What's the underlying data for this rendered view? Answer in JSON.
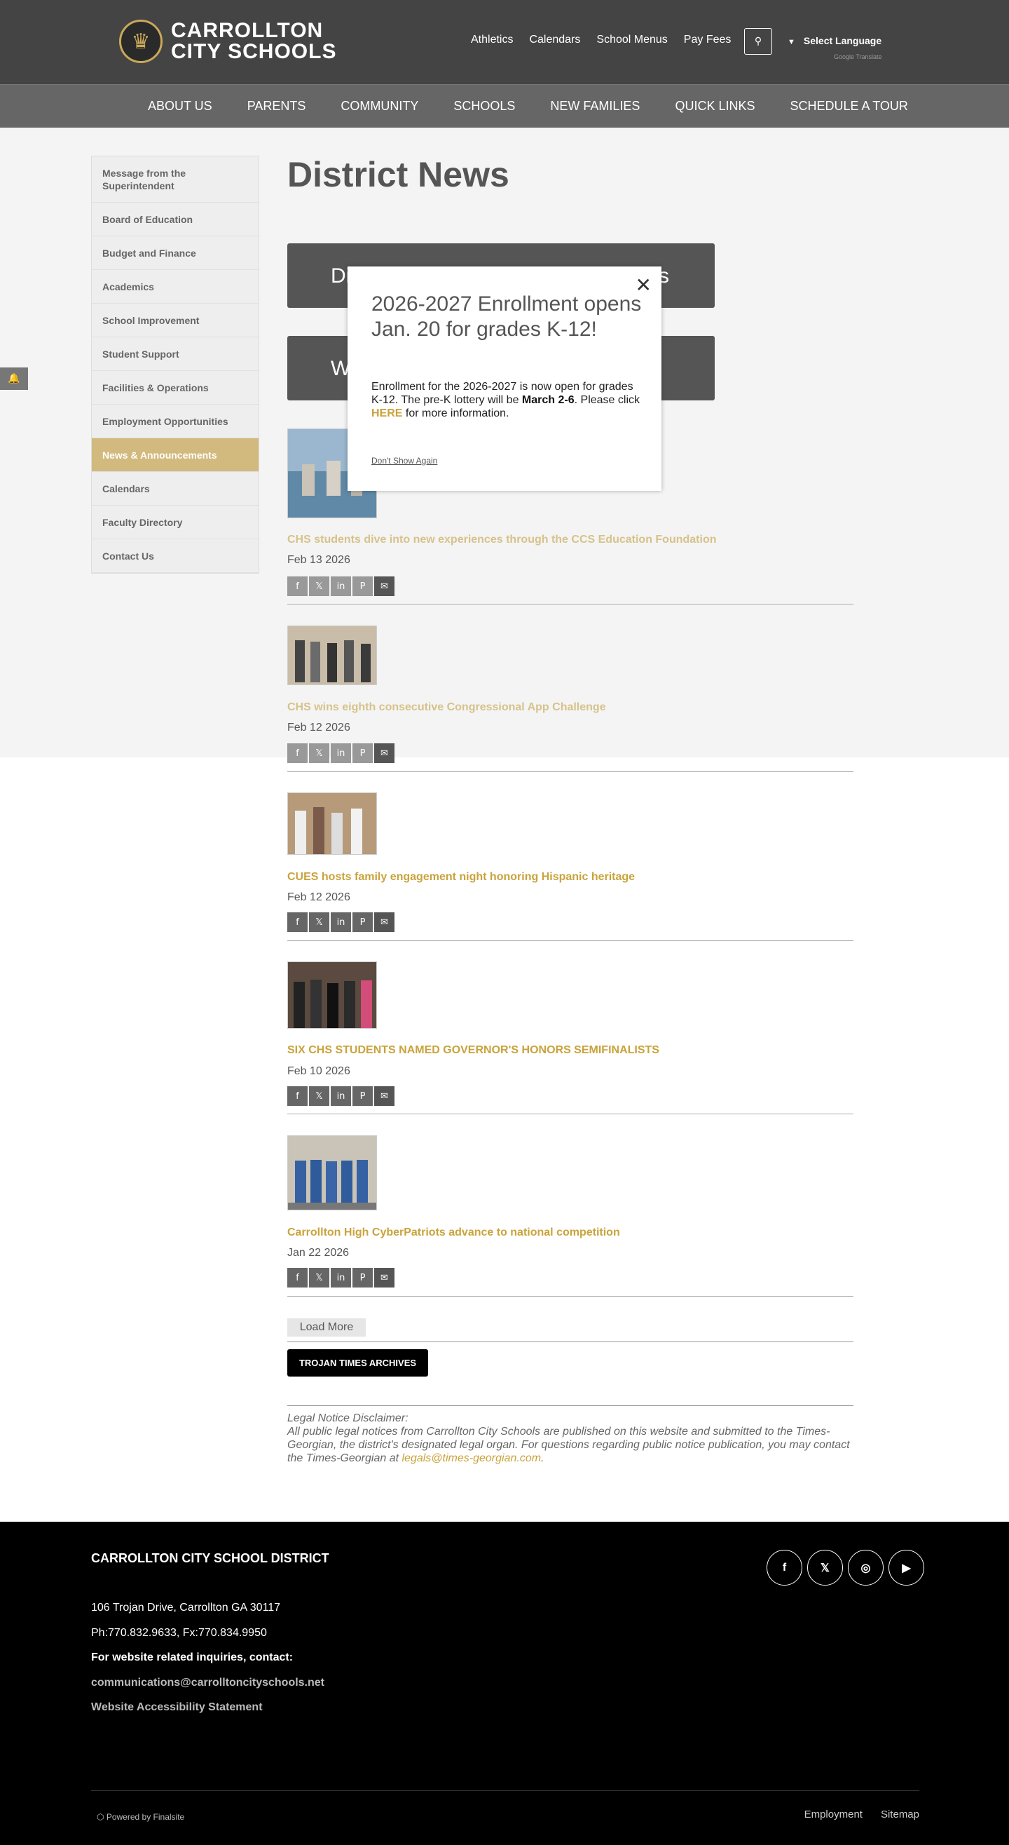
{
  "header": {
    "logo_line1": "CARROLLTON",
    "logo_line2": "CITY SCHOOLS",
    "top_links": [
      "Athletics",
      "Calendars",
      "School Menus",
      "Pay Fees"
    ],
    "language": "Select Language",
    "translate_label": "Google Translate"
  },
  "nav": [
    "ABOUT US",
    "PARENTS",
    "COMMUNITY",
    "SCHOOLS",
    "NEW FAMILIES",
    "QUICK LINKS",
    "SCHEDULE A TOUR"
  ],
  "sidebar": [
    {
      "label": "Message from the Superintendent"
    },
    {
      "label": "Board of Education"
    },
    {
      "label": "Budget and Finance"
    },
    {
      "label": "Academics"
    },
    {
      "label": "School Improvement"
    },
    {
      "label": "Student Support"
    },
    {
      "label": "Facilities & Operations"
    },
    {
      "label": "Employment Opportunities"
    },
    {
      "label": "News & Announcements"
    },
    {
      "label": "Calendars"
    },
    {
      "label": "Faculty Directory"
    },
    {
      "label": "Contact Us"
    }
  ],
  "page_title": "District News",
  "dark_buttons": [
    "Di",
    "s",
    "W"
  ],
  "news": [
    {
      "title": "CHS students dive into new experiences through the CCS Education Foundation",
      "date": "Feb 13 2026"
    },
    {
      "title": "CHS wins eighth consecutive Congressional App Challenge",
      "date": "Feb 12 2026"
    },
    {
      "title": "CUES hosts family engagement night honoring Hispanic heritage",
      "date": "Feb 12 2026"
    },
    {
      "title": "SIX CHS STUDENTS NAMED GOVERNOR'S HONORS SEMIFINALISTS",
      "date": "Feb 10 2026"
    },
    {
      "title": "Carrollton High CyberPatriots advance to national competition",
      "date": "Jan 22 2026"
    }
  ],
  "share_icons": [
    "facebook-icon",
    "x-icon",
    "linkedin-icon",
    "pinterest-icon",
    "email-icon"
  ],
  "load_more": "Load More",
  "archive_button": "TROJAN TIMES ARCHIVES",
  "legal": {
    "heading": "Legal Notice Disclaimer:",
    "body": "All public legal notices from Carrollton City Schools are published on this website and submitted to the Times-Georgian, the district's designated legal organ. For questions regarding public notice publication, you may contact the Times-Georgian at",
    "email": "legals@times-georgian.com",
    "end": "."
  },
  "modal": {
    "title": "2026-2027 Enrollment opens Jan. 20 for grades K-12!",
    "body_start": "Enrollment for the 2026-2027 is now open for grades K-12. The pre-K lottery will be",
    "body_bold": "March 2-6",
    "body_mid": ". Please click",
    "body_link": "HERE",
    "body_end": "for more information.",
    "dismiss": "Don't Show Again"
  },
  "footer": {
    "title": "CARROLLTON CITY SCHOOL DISTRICT",
    "address": "106 Trojan Drive, Carrollton GA 30117",
    "phone": "Ph:770.832.9633, Fx:770.834.9950",
    "inquiries": "For website related inquiries, contact:",
    "email": "communications@carrolltoncityschools.net",
    "accessibility": "Website Accessibility Statement",
    "powered": "Powered by Finalsite",
    "bottom_links": [
      "Employment",
      "Sitemap"
    ]
  },
  "colors": {
    "accent_gold": "#c9a33c",
    "header_grey": "#444444",
    "nav_grey": "#666666",
    "sidebar_active": "#d2b97d"
  }
}
